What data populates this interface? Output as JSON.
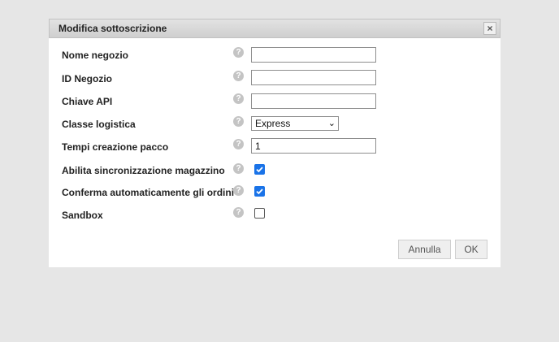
{
  "dialog": {
    "title": "Modifica sottoscrizione",
    "close_glyph": "×"
  },
  "help_glyph": "?",
  "fields": {
    "nome_negozio": {
      "label": "Nome negozio",
      "value": ""
    },
    "id_negozio": {
      "label": "ID Negozio",
      "value": ""
    },
    "chiave_api": {
      "label": "Chiave API",
      "value": ""
    },
    "classe_logistica": {
      "label": "Classe logistica",
      "selected": "Express"
    },
    "tempi_creazione": {
      "label": "Tempi creazione pacco",
      "value": "1"
    },
    "sync_magazzino": {
      "label": "Abilita sincronizzazione magazzino",
      "checked": true
    },
    "conferma_ordini": {
      "label": "Conferma automaticamente gli ordini",
      "checked": true
    },
    "sandbox": {
      "label": "Sandbox",
      "checked": false
    }
  },
  "buttons": {
    "cancel_label": "Annulla",
    "ok_label": "OK"
  },
  "colors": {
    "checkbox_accent": "#1a73e8",
    "titlebar": "#d9d9d9",
    "background": "#e6e6e6"
  }
}
